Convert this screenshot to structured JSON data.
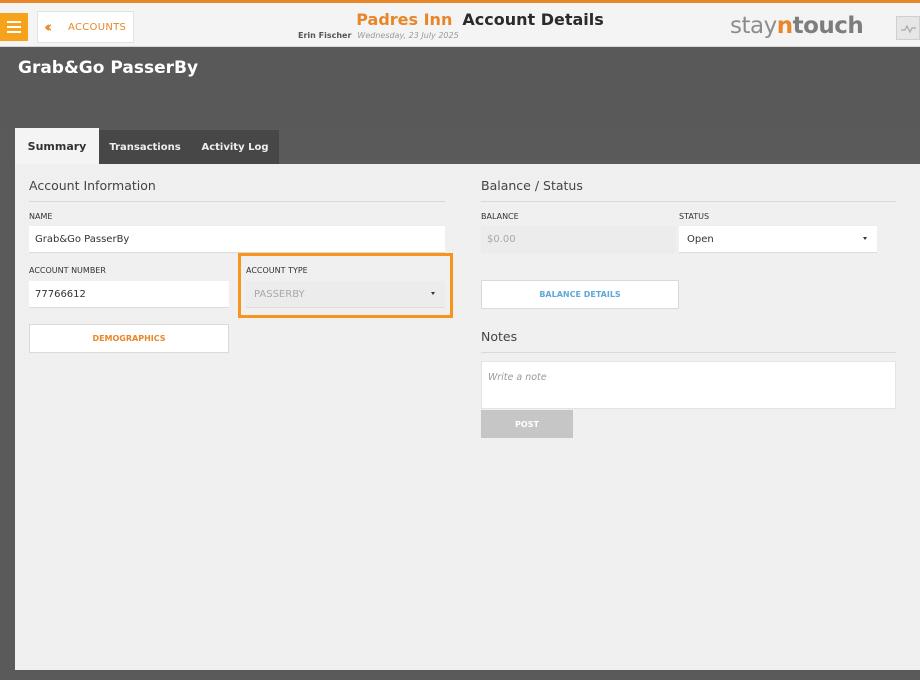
{
  "header": {
    "back_label": "ACCOUNTS",
    "hotel_name": "Padres Inn",
    "page_title": "Account Details",
    "user_name": "Erin Fischer",
    "date": "Wednesday, 23 July 2025",
    "brand": {
      "stay": "stay",
      "n": "n",
      "touch": "touch"
    }
  },
  "account": {
    "title": "Grab&Go PasserBy"
  },
  "tabs": [
    {
      "label": "Summary",
      "active": true
    },
    {
      "label": "Transactions",
      "active": false
    },
    {
      "label": "Activity Log",
      "active": false
    }
  ],
  "account_info": {
    "section_title": "Account Information",
    "name_label": "NAME",
    "name_value": "Grab&Go PasserBy",
    "number_label": "ACCOUNT NUMBER",
    "number_value": "77766612",
    "type_label": "ACCOUNT TYPE",
    "type_value": "PASSERBY",
    "demographics_label": "DEMOGRAPHICS"
  },
  "balance_status": {
    "section_title": "Balance / Status",
    "balance_label": "BALANCE",
    "balance_value": "$0.00",
    "status_label": "STATUS",
    "status_value": "Open",
    "balance_details_label": "BALANCE DETAILS"
  },
  "notes": {
    "section_title": "Notes",
    "placeholder": "Write a note",
    "post_label": "POST"
  },
  "colors": {
    "accent": "#e8862a",
    "highlight": "#f7941d",
    "link_blue": "#5fa8d8",
    "panel_bg": "#f0f0f0",
    "header_dark": "#595959"
  },
  "icons": {
    "menu": "hamburger-icon",
    "back": "double-chevron-left-icon",
    "activity": "activity-graph-icon",
    "dropdown": "caret-down-icon"
  }
}
